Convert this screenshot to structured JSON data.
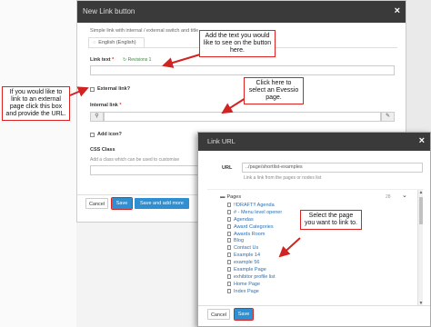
{
  "modal_link_button": {
    "title": "New Link button",
    "close": "×",
    "subtitle": "Simple link with internal / external switch and title",
    "language_tab": "English (English)",
    "link_text_label": "Link text",
    "required_mark": "*",
    "revisions": "Revisions 1",
    "external_link_label": "External link?",
    "internal_link_label": "Internal link",
    "internal_link_icon": "link-icon",
    "picker_icon": "pen-icon",
    "add_icon_label": "Add icon?",
    "css_class_label": "CSS Class",
    "css_class_hint": "Add a class which can be used to customise",
    "cancel_button": "Cancel",
    "save_button": "Save",
    "save_add_more_button": "Save and add more"
  },
  "modal_link_url": {
    "title": "Link URL",
    "close": "×",
    "url_label": "URL",
    "url_value": "../page/shortlist-examples",
    "url_hint": "Link a link from the pages or nodes list",
    "pages_label": "Pages",
    "pages_count": "28",
    "pages": [
      "!!DRAFT!! Agenda",
      "# - Menu level opener",
      "Agendas",
      "Award Categories",
      "Awards Room",
      "Blog",
      "Contact Us",
      "Example 14",
      "example 56",
      "Example Page",
      "exhibitor profile list",
      "Home Page",
      "Index Page"
    ],
    "cancel_button": "Cancel",
    "save_button": "Save"
  },
  "callouts": {
    "text_callout": "Add the text you would like to see on the button here.",
    "external_callout": "If you would like to link to an external page click this box and provide the URL.",
    "internal_callout": "Click here to select an Evessio page.",
    "select_callout": "Select the page you want to link to."
  },
  "colors": {
    "header_bg": "#3a3a3a",
    "primary": "#2f8fd0",
    "callout_border": "#d22222",
    "link": "#2a6fb5"
  }
}
